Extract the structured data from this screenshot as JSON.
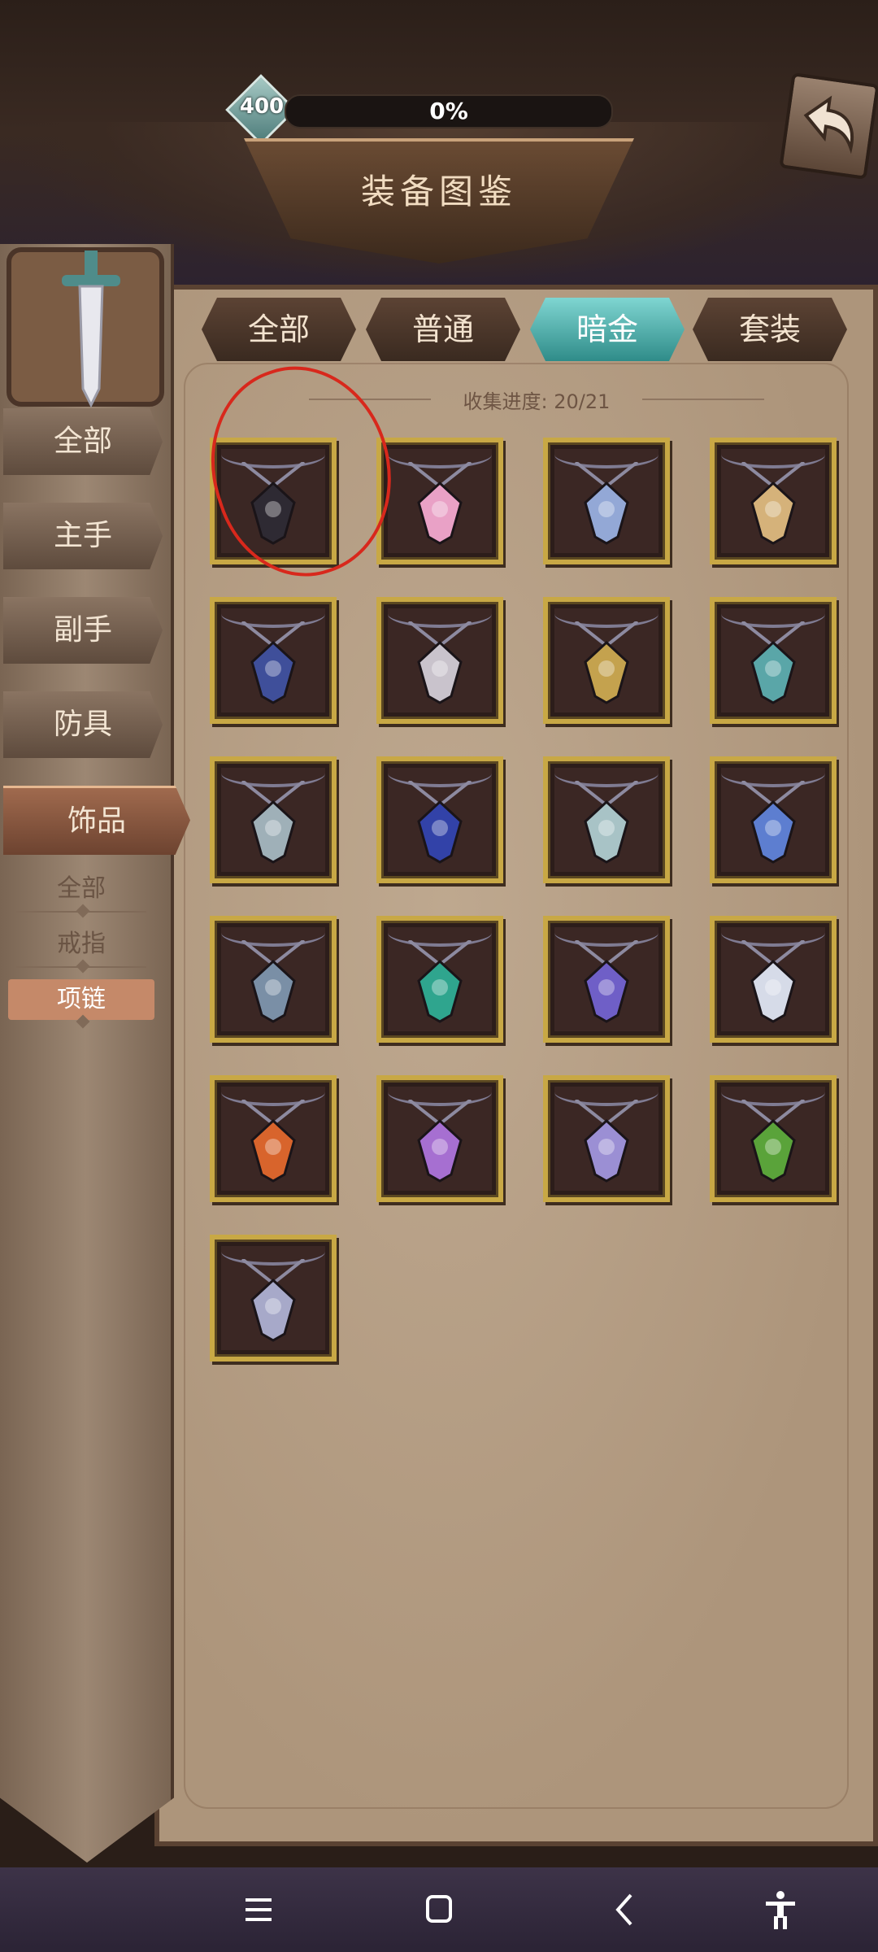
{
  "header": {
    "currency": "400",
    "progress_text": "0%",
    "progress": 0,
    "title": "装备图鉴"
  },
  "tabs": [
    {
      "label": "全部",
      "active": false
    },
    {
      "label": "普通",
      "active": false
    },
    {
      "label": "暗金",
      "active": true
    },
    {
      "label": "套装",
      "active": false
    }
  ],
  "collection": {
    "label": "收集进度: 20/21"
  },
  "sidebar": {
    "categories": [
      {
        "label": "全部"
      },
      {
        "label": "主手"
      },
      {
        "label": "副手"
      },
      {
        "label": "防具"
      },
      {
        "label": "饰品",
        "active": true
      }
    ],
    "subcategories": [
      {
        "label": "全部"
      },
      {
        "label": "戒指"
      },
      {
        "label": "项链",
        "active": true
      }
    ]
  },
  "items": [
    {
      "icon": "dark-crystal-necklace-icon",
      "color": "#2e2a33"
    },
    {
      "icon": "pink-flame-necklace-icon",
      "color": "#e9a1c6"
    },
    {
      "icon": "blue-gem-pendant-icon",
      "color": "#93a8d6"
    },
    {
      "icon": "cross-shield-pendant-icon",
      "color": "#d5b27a"
    },
    {
      "icon": "compass-amulet-icon",
      "color": "#3f4f9a"
    },
    {
      "icon": "rose-shield-pendant-icon",
      "color": "#c9c3cc"
    },
    {
      "icon": "lion-head-pendant-icon",
      "color": "#c4a24e"
    },
    {
      "icon": "crescent-moon-pendant-icon",
      "color": "#5aa6a8"
    },
    {
      "icon": "silver-disc-amulet-icon",
      "color": "#9fb0b8"
    },
    {
      "icon": "blue-heart-pendant-icon",
      "color": "#3242a8"
    },
    {
      "icon": "cyan-gear-amulet-icon",
      "color": "#a8c3c6"
    },
    {
      "icon": "witch-eye-pendant-icon",
      "color": "#5d7ed0"
    },
    {
      "icon": "serpent-pendant-icon",
      "color": "#7a8fa6"
    },
    {
      "icon": "emerald-orb-pendant-icon",
      "color": "#2fa58e"
    },
    {
      "icon": "purple-seal-pendant-icon",
      "color": "#6f5fc7"
    },
    {
      "icon": "lightning-pendant-icon",
      "color": "#d6dbe8"
    },
    {
      "icon": "fire-crystal-pendant-icon",
      "color": "#d8642c"
    },
    {
      "icon": "chained-hood-pendant-icon",
      "color": "#a66fd1"
    },
    {
      "icon": "violet-crystal-pendant-icon",
      "color": "#9b8fd4"
    },
    {
      "icon": "green-potion-pendant-icon",
      "color": "#5aa33a"
    },
    {
      "icon": "ghost-skull-pendant-icon",
      "color": "#a7a9c9"
    }
  ],
  "highlight": {
    "item": 0,
    "color": "#d8281c"
  }
}
